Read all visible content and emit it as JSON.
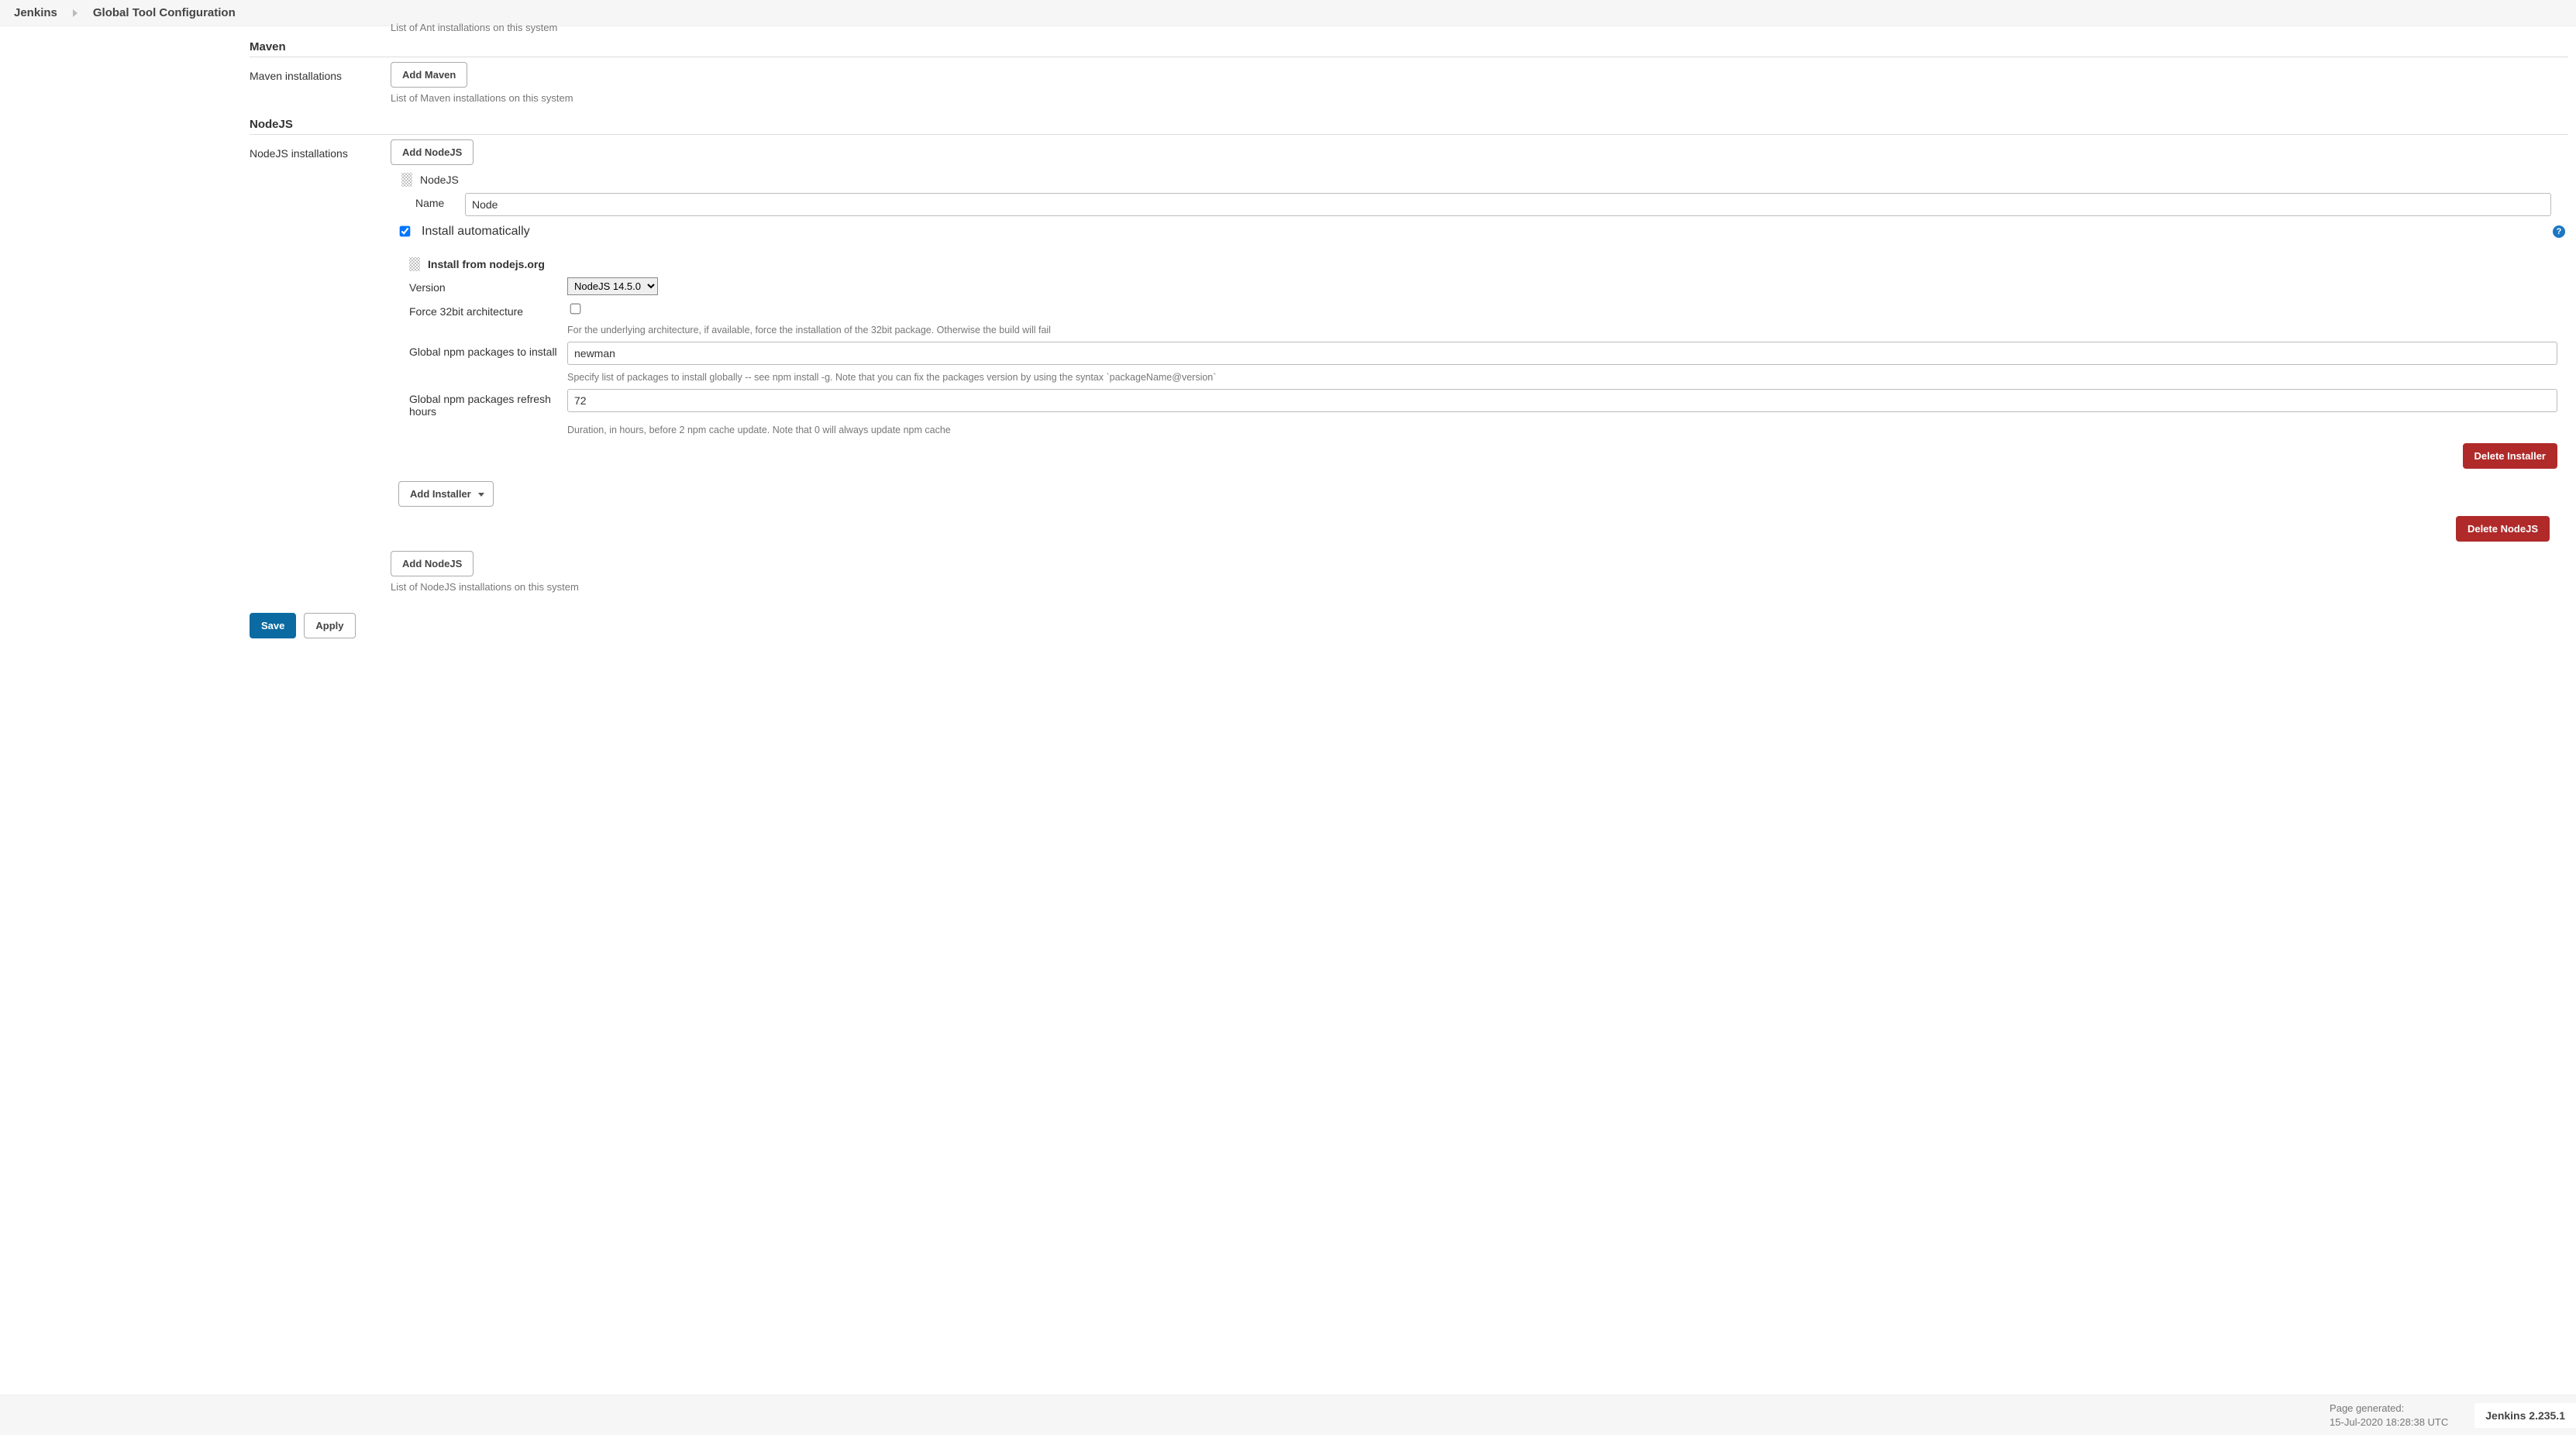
{
  "breadcrumb": {
    "root": "Jenkins",
    "page": "Global Tool Configuration"
  },
  "cutoff": {
    "ant_list_desc": "List of Ant installations on this system"
  },
  "maven": {
    "section": "Maven",
    "installs_label": "Maven installations",
    "add_btn": "Add Maven",
    "list_desc": "List of Maven installations on this system"
  },
  "nodejs": {
    "section": "NodeJS",
    "installs_label": "NodeJS installations",
    "add_btn_top": "Add NodeJS",
    "add_btn_bottom": "Add NodeJS",
    "list_desc": "List of NodeJS installations on this system",
    "block_title": "NodeJS",
    "name_label": "Name",
    "name_value": "Node",
    "autoinstall": {
      "checked": true,
      "label": "Install automatically"
    },
    "installer": {
      "title": "Install from nodejs.org",
      "version_label": "Version",
      "version_value": "NodeJS 14.5.0",
      "force32_label": "Force 32bit architecture",
      "force32_checked": false,
      "force32_desc": "For the underlying architecture, if available, force the installation of the 32bit package. Otherwise the build will fail",
      "global_pkgs_label": "Global npm packages to install",
      "global_pkgs_value": "newman",
      "global_pkgs_desc": "Specify list of packages to install globally -- see npm install -g. Note that you can fix the packages version by using the syntax `packageName@version`",
      "refresh_label": "Global npm packages refresh hours",
      "refresh_value": "72",
      "refresh_desc": "Duration, in hours, before 2 npm cache update. Note that 0 will always update npm cache",
      "delete_installer_btn": "Delete Installer"
    },
    "add_installer_btn": "Add Installer",
    "delete_nodejs_btn": "Delete NodeJS"
  },
  "actions": {
    "save": "Save",
    "apply": "Apply"
  },
  "footer": {
    "gen_label": "Page generated:",
    "gen_ts": "15-Jul-2020 18:28:38 UTC",
    "version": "Jenkins 2.235.1"
  }
}
